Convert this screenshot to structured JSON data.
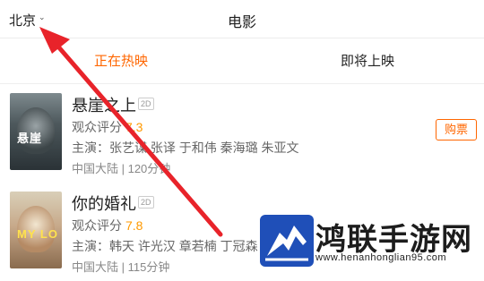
{
  "header": {
    "city": "北京",
    "city_caret": "⌄",
    "title": "电影"
  },
  "tabs": [
    {
      "label": "正在热映",
      "active": true
    },
    {
      "label": "即将上映",
      "active": false
    }
  ],
  "movies": [
    {
      "title": "悬崖之上",
      "format": "2D",
      "rating_label": "观众评分",
      "score": "7.3",
      "cast": "主演：张艺谋 张译 于和伟 秦海璐 朱亚文",
      "meta": "中国大陆 | 120分钟",
      "poster_text": "悬崖",
      "buy_label": "购票"
    },
    {
      "title": "你的婚礼",
      "format": "2D",
      "rating_label": "观众评分",
      "score": "7.8",
      "cast": "主演：韩天 许光汉 章若楠 丁冠森 张",
      "meta": "中国大陆 | 115分钟",
      "poster_text": "MY LO"
    }
  ],
  "watermark": {
    "name": "鸿联手游网",
    "url": "www.henanhonglian95.com"
  },
  "colors": {
    "accent": "#ff6600",
    "score": "#ff9900",
    "annotation_arrow": "#e8232a"
  }
}
